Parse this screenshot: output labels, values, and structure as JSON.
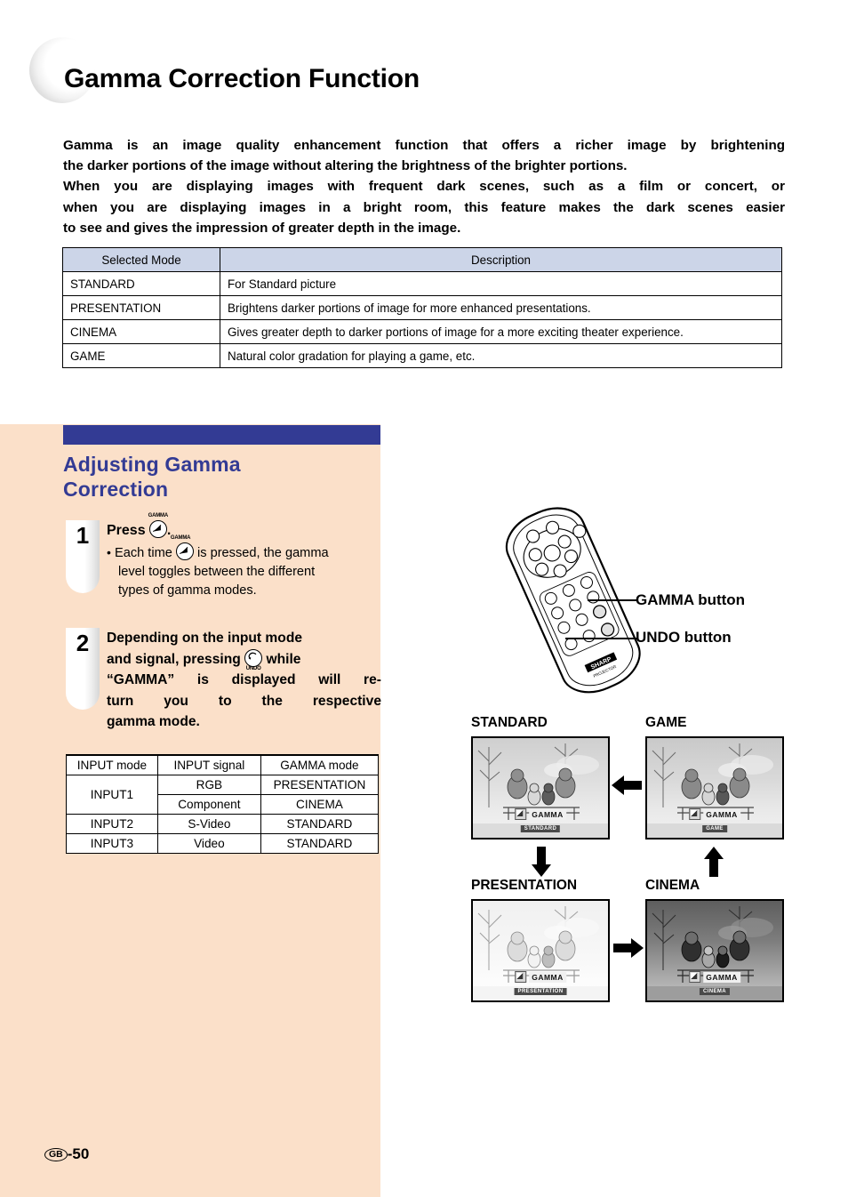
{
  "page": {
    "title": "Gamma Correction Function",
    "footer_locale": "GB",
    "footer_page": "-50"
  },
  "intro": {
    "lines": [
      "Gamma is an image quality enhancement function that offers a richer image by brightening",
      "the darker portions of the image without altering the brightness of the brighter portions.",
      "When you are displaying images with frequent dark scenes, such as a film or concert, or",
      "when you are displaying images in a bright room, this feature makes the dark scenes easier",
      "to see and gives the impression of greater depth in the image."
    ]
  },
  "mode_table": {
    "headers": [
      "Selected Mode",
      "Description"
    ],
    "rows": [
      [
        "STANDARD",
        "For Standard picture"
      ],
      [
        "PRESENTATION",
        "Brightens darker portions of image for more enhanced presentations."
      ],
      [
        "CINEMA",
        "Gives greater depth to darker portions of image for a more exciting theater experience."
      ],
      [
        "GAME",
        "Natural color gradation for playing a game, etc."
      ]
    ]
  },
  "section": {
    "heading_line1": "Adjusting Gamma",
    "heading_line2": "Correction",
    "accent_color": "#333b94"
  },
  "steps": [
    {
      "number": "1",
      "lead_before": "Press",
      "lead_after": ".",
      "key_icon": "gamma-button-icon",
      "key_label": "GAMMA",
      "bullet_prefix": "Each time",
      "bullet_l1": "is pressed, the gamma",
      "bullet_l2": "level  toggles  between  the  different",
      "bullet_l3": "types of gamma modes."
    },
    {
      "number": "2",
      "l1a": "Depending on the input mode",
      "l2a": "and signal, pressing",
      "l2b": "while",
      "l3": "“GAMMA” is displayed will re-",
      "l4": "turn you to the respective",
      "l5": "gamma mode.",
      "key_icon": "undo-button-icon",
      "key_label": "UNDO"
    }
  ],
  "input_table": {
    "headers": [
      "INPUT mode",
      "INPUT signal",
      "GAMMA mode"
    ],
    "rows": [
      {
        "mode": "INPUT1",
        "signal": "RGB",
        "gamma": "PRESENTATION"
      },
      {
        "mode": "",
        "signal": "Component",
        "gamma": "CINEMA"
      },
      {
        "mode": "INPUT2",
        "signal": "S-Video",
        "gamma": "STANDARD"
      },
      {
        "mode": "INPUT3",
        "signal": "Video",
        "gamma": "STANDARD"
      }
    ]
  },
  "remote": {
    "brand": "SHARP",
    "sub_brand": "PROJECTOR",
    "callouts": [
      {
        "label": "GAMMA button"
      },
      {
        "label": "UNDO button"
      }
    ]
  },
  "gamma_shots": [
    {
      "label": "STANDARD",
      "osd_main": "GAMMA",
      "osd_sub": "STANDARD"
    },
    {
      "label": "GAME",
      "osd_main": "GAMMA",
      "osd_sub": "GAME"
    },
    {
      "label": "PRESENTATION",
      "osd_main": "GAMMA",
      "osd_sub": "PRESENTATION"
    },
    {
      "label": "CINEMA",
      "osd_main": "GAMMA",
      "osd_sub": "CINEMA"
    }
  ]
}
